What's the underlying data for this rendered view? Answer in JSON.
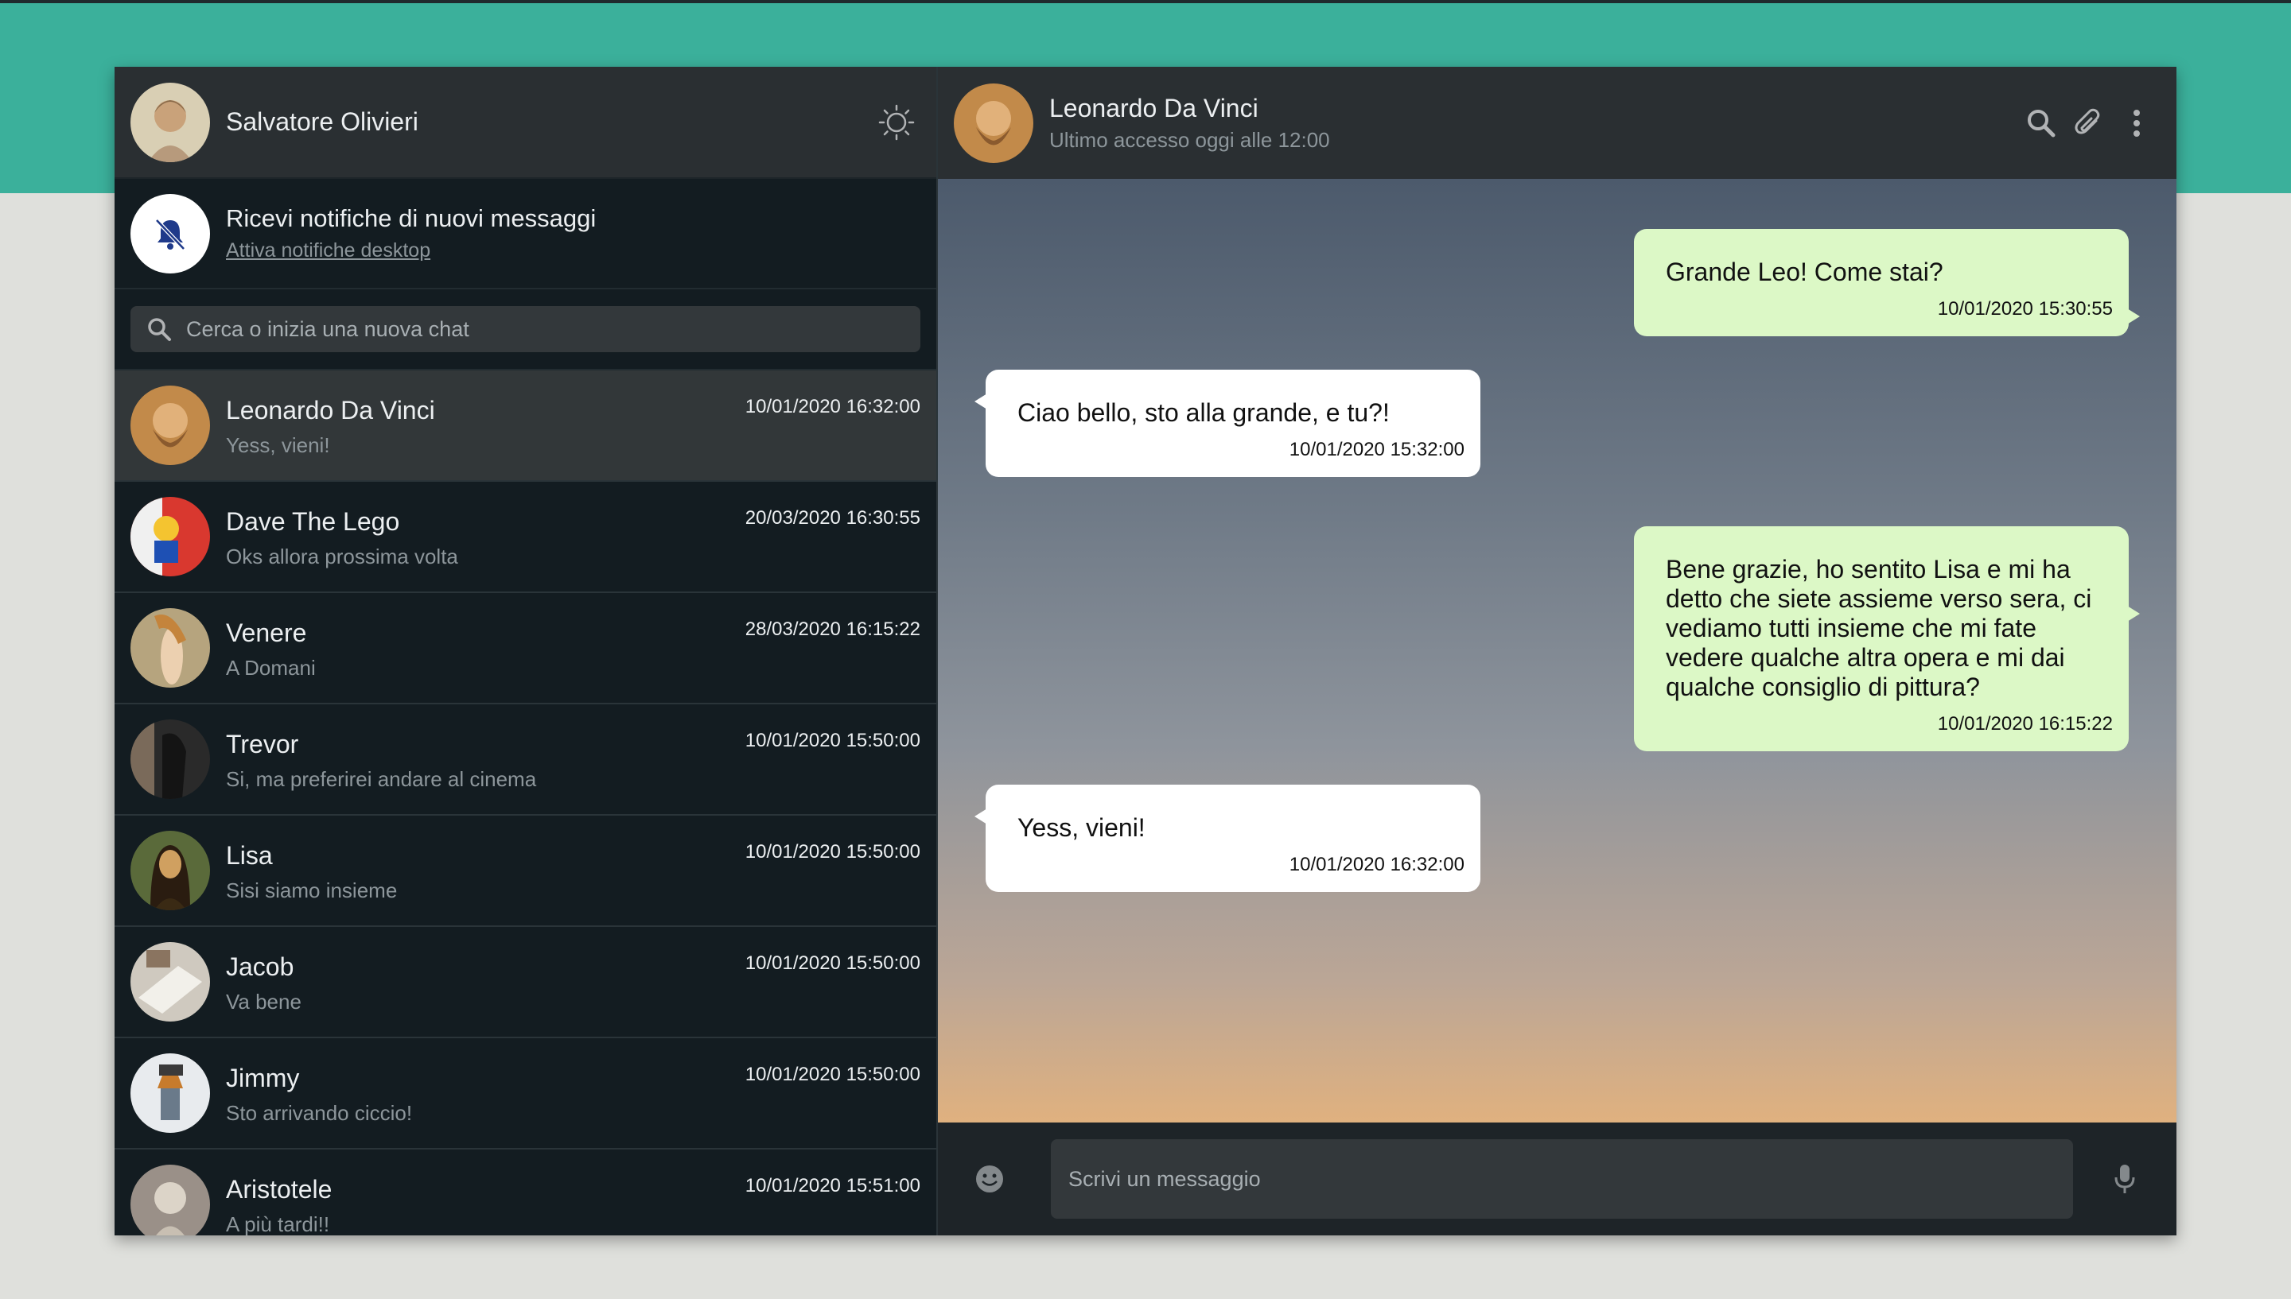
{
  "user": {
    "name": "Salvatore Olivieri"
  },
  "notification": {
    "title": "Ricevi notifiche di nuovi messaggi",
    "link": "Attiva notifiche desktop"
  },
  "search": {
    "placeholder": "Cerca o inizia una nuova chat"
  },
  "chats": [
    {
      "name": "Leonardo Da Vinci",
      "last": "Yess, vieni!",
      "time": "10/01/2020 16:32:00"
    },
    {
      "name": "Dave The Lego",
      "last": "Oks allora prossima volta",
      "time": "20/03/2020 16:30:55"
    },
    {
      "name": "Venere",
      "last": "A Domani",
      "time": "28/03/2020 16:15:22"
    },
    {
      "name": "Trevor",
      "last": "Si, ma preferirei andare al cinema",
      "time": "10/01/2020 15:50:00"
    },
    {
      "name": "Lisa",
      "last": "Sisi siamo insieme",
      "time": "10/01/2020 15:50:00"
    },
    {
      "name": "Jacob",
      "last": "Va bene",
      "time": "10/01/2020 15:50:00"
    },
    {
      "name": "Jimmy",
      "last": "Sto arrivando ciccio!",
      "time": "10/01/2020 15:50:00"
    },
    {
      "name": "Aristotele",
      "last": "A più tardi!!",
      "time": "10/01/2020 15:51:00"
    }
  ],
  "contact": {
    "name": "Leonardo Da Vinci",
    "status": "Ultimo accesso oggi alle 12:00"
  },
  "messages": [
    {
      "type": "sent",
      "text": "Grande Leo! Come stai?",
      "time": "10/01/2020 15:30:55"
    },
    {
      "type": "received",
      "text": "Ciao bello, sto alla grande, e tu?!",
      "time": "10/01/2020 15:32:00"
    },
    {
      "type": "sent",
      "text": "Bene grazie, ho sentito Lisa e mi ha detto che siete assieme verso sera, ci vediamo tutti insieme che mi fate vedere qualche altra opera e mi dai qualche consiglio di pittura?",
      "time": "10/01/2020 16:15:22"
    },
    {
      "type": "received",
      "text": "Yess, vieni!",
      "time": "10/01/2020 16:32:00"
    }
  ],
  "compose": {
    "placeholder": "Scrivi un messaggio"
  },
  "icons": {
    "theme": "sun-icon",
    "bell": "bell-slash-icon",
    "search": "search-icon",
    "header_search": "search-icon",
    "attach": "paperclip-icon",
    "menu": "vertical-dots-icon",
    "emoji": "emoji-icon",
    "mic": "microphone-icon"
  },
  "colors": {
    "accent": "#3bb09b",
    "sidebar_bg": "#131c21",
    "header_bg": "#2a2f32",
    "sent_bubble": "#dcf8c6",
    "received_bubble": "#ffffff"
  }
}
